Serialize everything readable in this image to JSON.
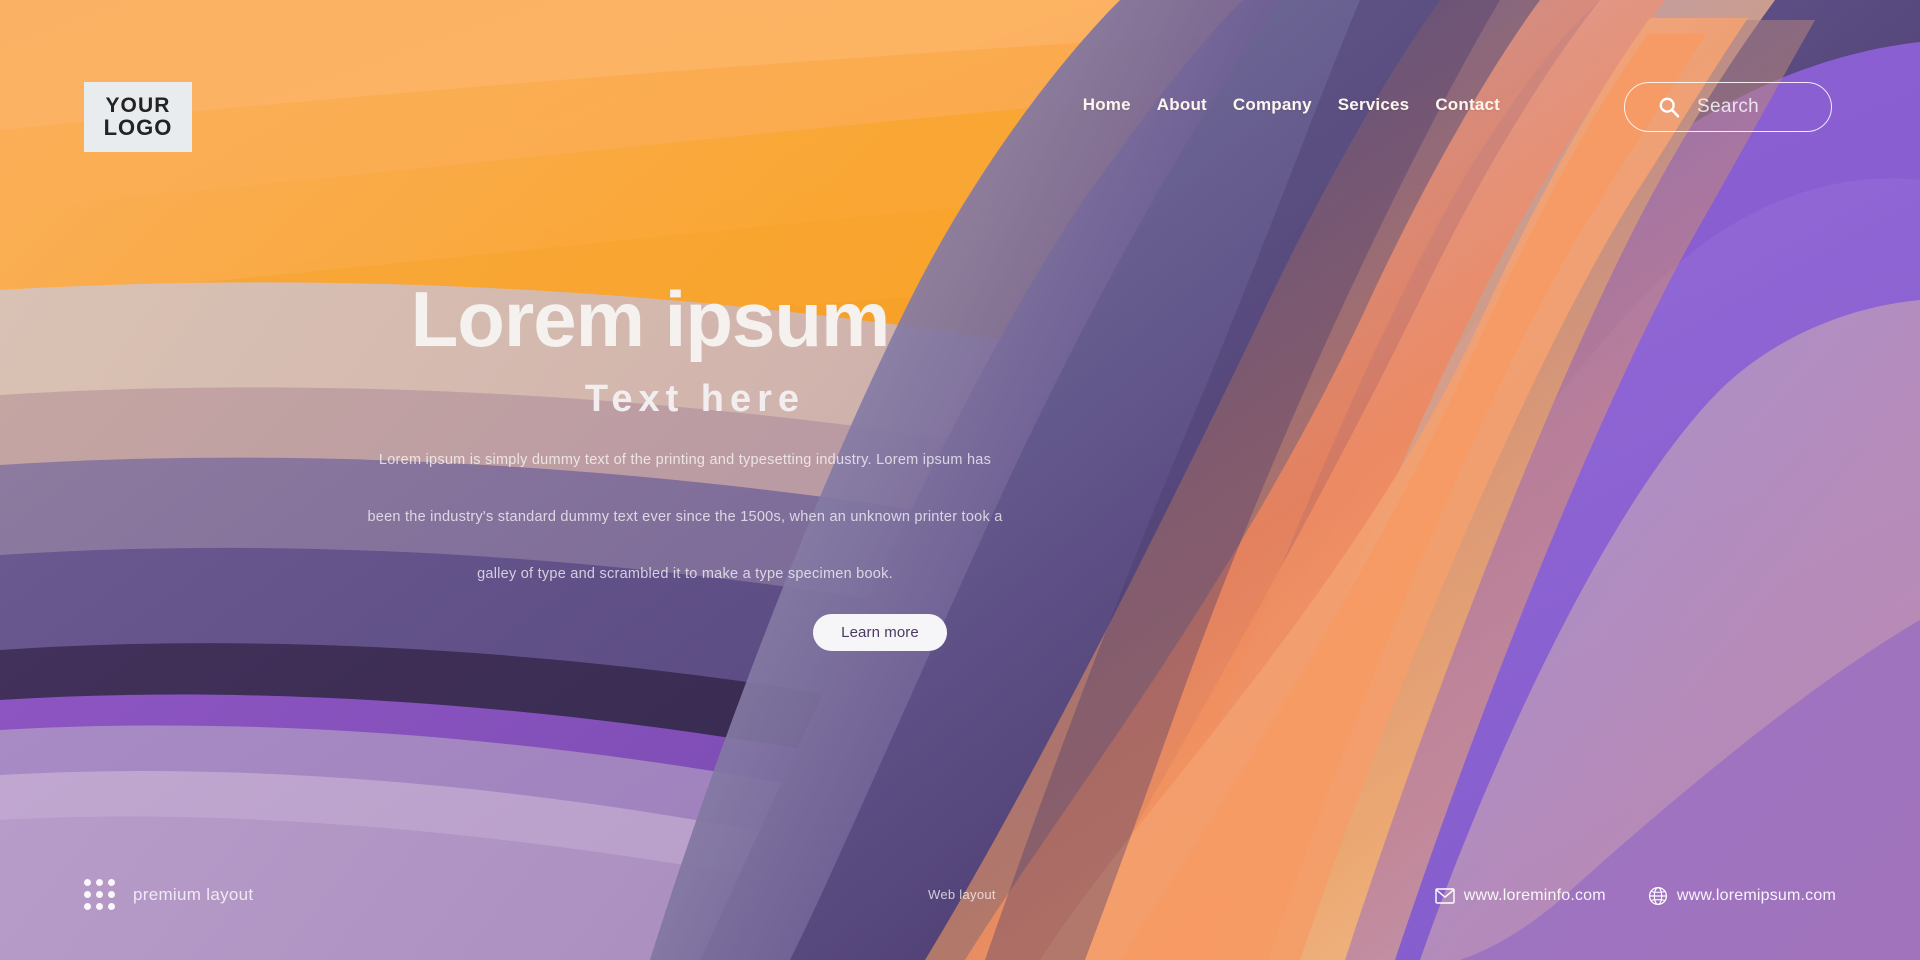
{
  "header": {
    "logo": {
      "line1": "YOUR",
      "line2": "LOGO",
      "icon": "logo-box"
    },
    "nav": [
      {
        "label": "Home"
      },
      {
        "label": "About"
      },
      {
        "label": "Company"
      },
      {
        "label": "Services"
      },
      {
        "label": "Contact"
      }
    ],
    "search": {
      "placeholder": "Search",
      "value": "",
      "icon": "search-icon"
    }
  },
  "hero": {
    "title": "Lorem ipsum",
    "subtitle": "Text here",
    "paragraph_lines": [
      "Lorem ipsum is simply dummy text of the printing and typesetting industry. Lorem ipsum has",
      "been the industry's standard dummy text ever since the 1500s, when an unknown printer took a",
      "galley of type and scrambled it to make a type specimen book."
    ],
    "cta_label": "Learn more"
  },
  "footer": {
    "premium_label": "premium layout",
    "premium_icon": "dot-grid-icon",
    "web_label": "Web layout",
    "contacts": [
      {
        "label": "www.loreminfo.com",
        "icon": "envelope-icon"
      },
      {
        "label": "www.loremipsum.com",
        "icon": "globe-icon"
      }
    ]
  },
  "colors": {
    "orange_light": "#fbb164",
    "orange": "#f8a22b",
    "orange_deep": "#ef8d4a",
    "salmon": "#f59070",
    "peach": "#f5b183",
    "purple_deep": "#3b2a4e",
    "purple_mid": "#5c4a7e",
    "purple_bright": "#8c5fd0",
    "purple_light": "#b59ac9",
    "mauve": "#c3a6bd",
    "white": "#ffffff",
    "logo_text": "#232323"
  }
}
